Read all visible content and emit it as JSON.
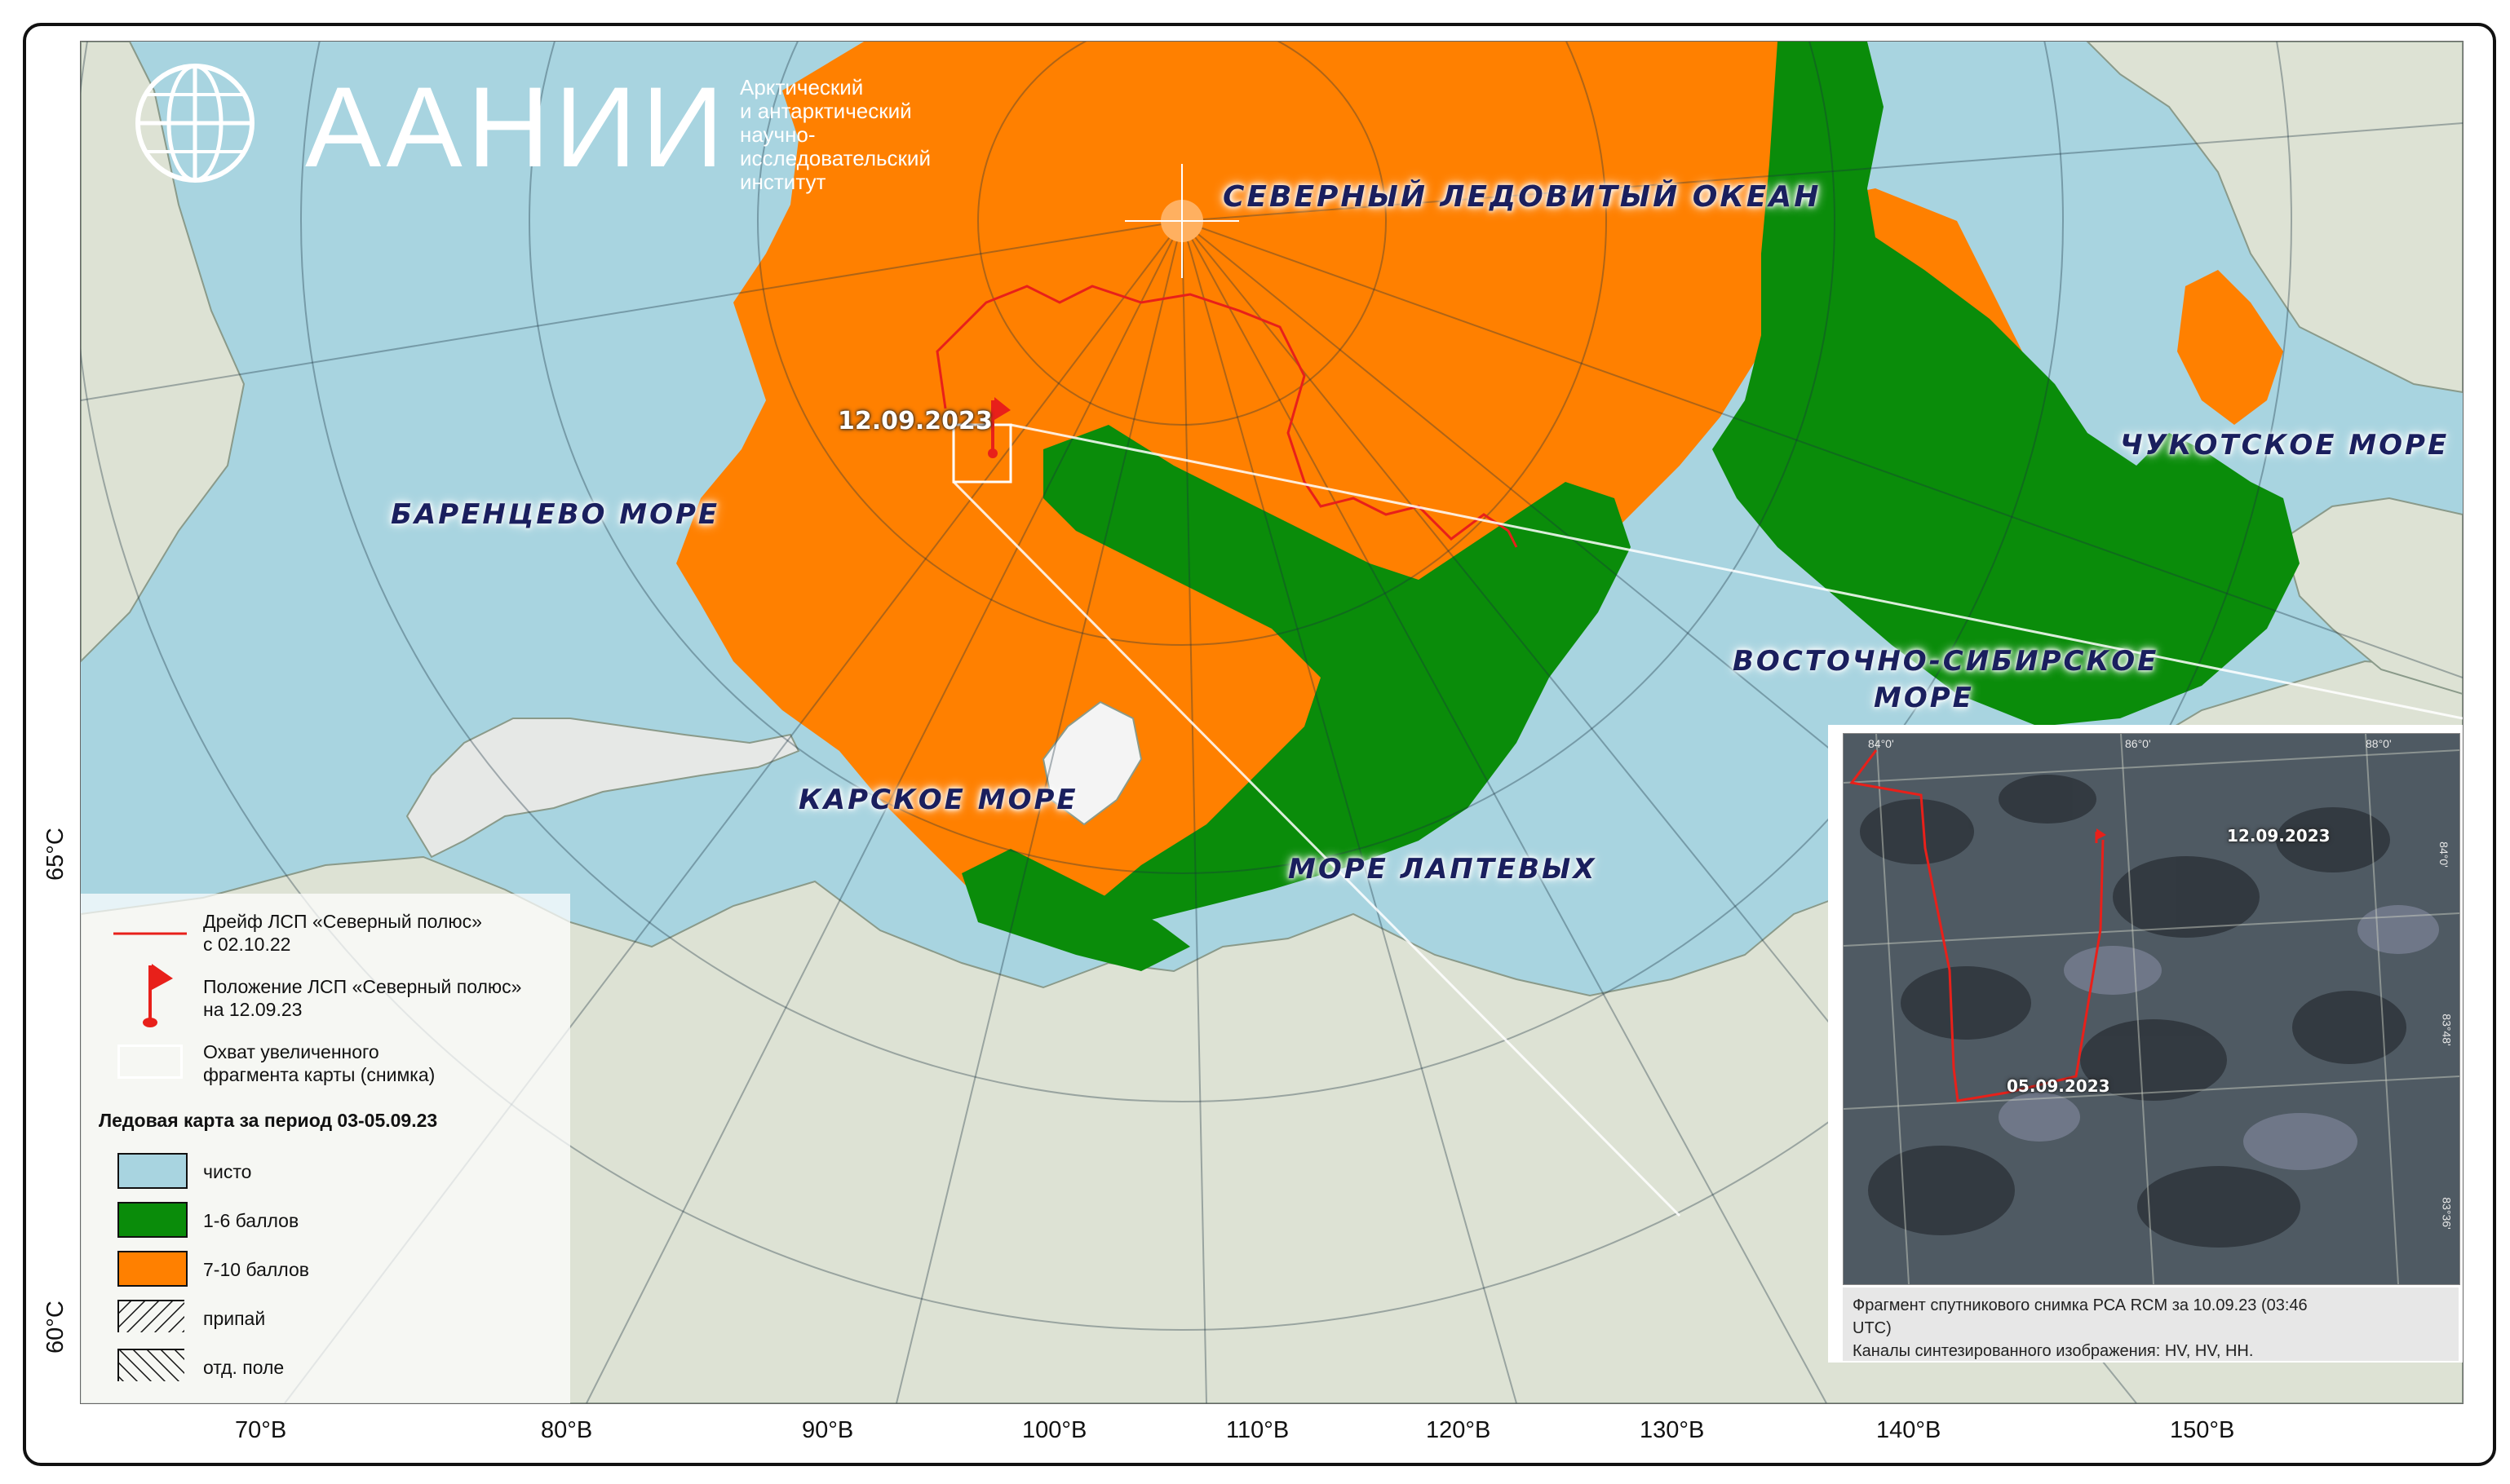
{
  "logo": {
    "name": "ААНИИ",
    "subtitle_lines": [
      "Арктический",
      "и антарктический",
      "научно-исследовательский",
      "институт"
    ]
  },
  "sea_labels": {
    "arctic_ocean": "СЕВЕРНЫЙ ЛЕДОВИТЫЙ ОКЕАН",
    "barents": "БАРЕНЦЕВО МОРЕ",
    "kara": "КАРСКОЕ МОРЕ",
    "laptev": "МОРЕ ЛАПТЕВЫХ",
    "east_siberian_1": "ВОСТОЧНО-СИБИРСКОЕ",
    "east_siberian_2": "МОРЕ",
    "chukchi": "ЧУКОТСКОЕ МОРЕ"
  },
  "station_date": "12.09.2023",
  "legend": {
    "drift_line_1": "Дрейф ЛСП «Северный полюс»",
    "drift_line_2": "с 02.10.22",
    "position_line_1": "Положение ЛСП «Северный полюс»",
    "position_line_2": "на 12.09.23",
    "coverage_line_1": "Охват увеличенного",
    "coverage_line_2": "фрагмента карты (снимка)",
    "title": "Ледовая карта за период 03-05.09.23",
    "items": [
      {
        "label": "чисто",
        "color": "#a8d4e0"
      },
      {
        "label": "1-6 баллов",
        "color": "#0a8c0a"
      },
      {
        "label": "7-10 баллов",
        "color": "#ff8000"
      },
      {
        "label": "припай",
        "pattern": "hatch-right"
      },
      {
        "label": "отд. поле",
        "pattern": "hatch-left"
      }
    ]
  },
  "inset": {
    "top_ticks": [
      "84°0'",
      "86°0'",
      "88°0'"
    ],
    "right_ticks": [
      "84°0'",
      "83°48'",
      "83°36'"
    ],
    "date_start": "05.09.2023",
    "date_end": "12.09.2023",
    "caption_line_1": "Фрагмент спутникового снимка РСА RCM за 10.09.23 (03:46",
    "caption_line_2": "UTC)",
    "caption_line_3": "Каналы синтезированного изображения: HV, HV, HH."
  },
  "axes": {
    "bottom": [
      "70°В",
      "80°В",
      "90°В",
      "100°В",
      "110°В",
      "120°В",
      "130°В",
      "140°В",
      "150°В"
    ],
    "left": [
      "65°С",
      "60°С"
    ]
  },
  "colors": {
    "water": "#a8d4e0",
    "ice_1_6": "#0a8c0a",
    "ice_7_10": "#ff8000",
    "land": "#dfe3d6",
    "drift": "#e8201a"
  }
}
